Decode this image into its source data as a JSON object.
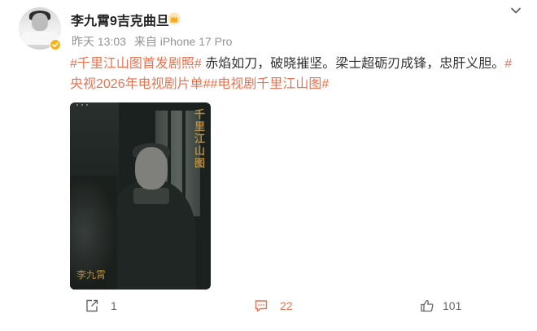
{
  "post": {
    "username": "李九霄9吉克曲旦",
    "meta": {
      "time": "昨天 13:03",
      "source": "来自 iPhone 17 Pro"
    },
    "content": {
      "hashtag_1": "#千里江山图首发剧照#",
      "text": " 赤焰如刀，破晓摧坚。梁士超砺刃成锋，忠肝义胆。",
      "hashtag_2": "#央视2026年电视剧片单#",
      "hashtag_3": "#电视剧千里江山图#"
    },
    "media": {
      "title_vertical": "千里江山图",
      "name_watermark": "李九霄"
    },
    "actions": {
      "repost_count": "1",
      "comment_count": "22",
      "like_count": "101"
    }
  },
  "icons": {
    "verified": "verified-badge-icon",
    "crown": "crown-icon",
    "menu": "chevron-down-icon",
    "repost": "repost-icon",
    "comment": "comment-icon",
    "like": "thumbs-up-icon"
  },
  "colors": {
    "accent": "#eb7350",
    "verified": "#f5b51a",
    "meta_text": "#939393"
  }
}
